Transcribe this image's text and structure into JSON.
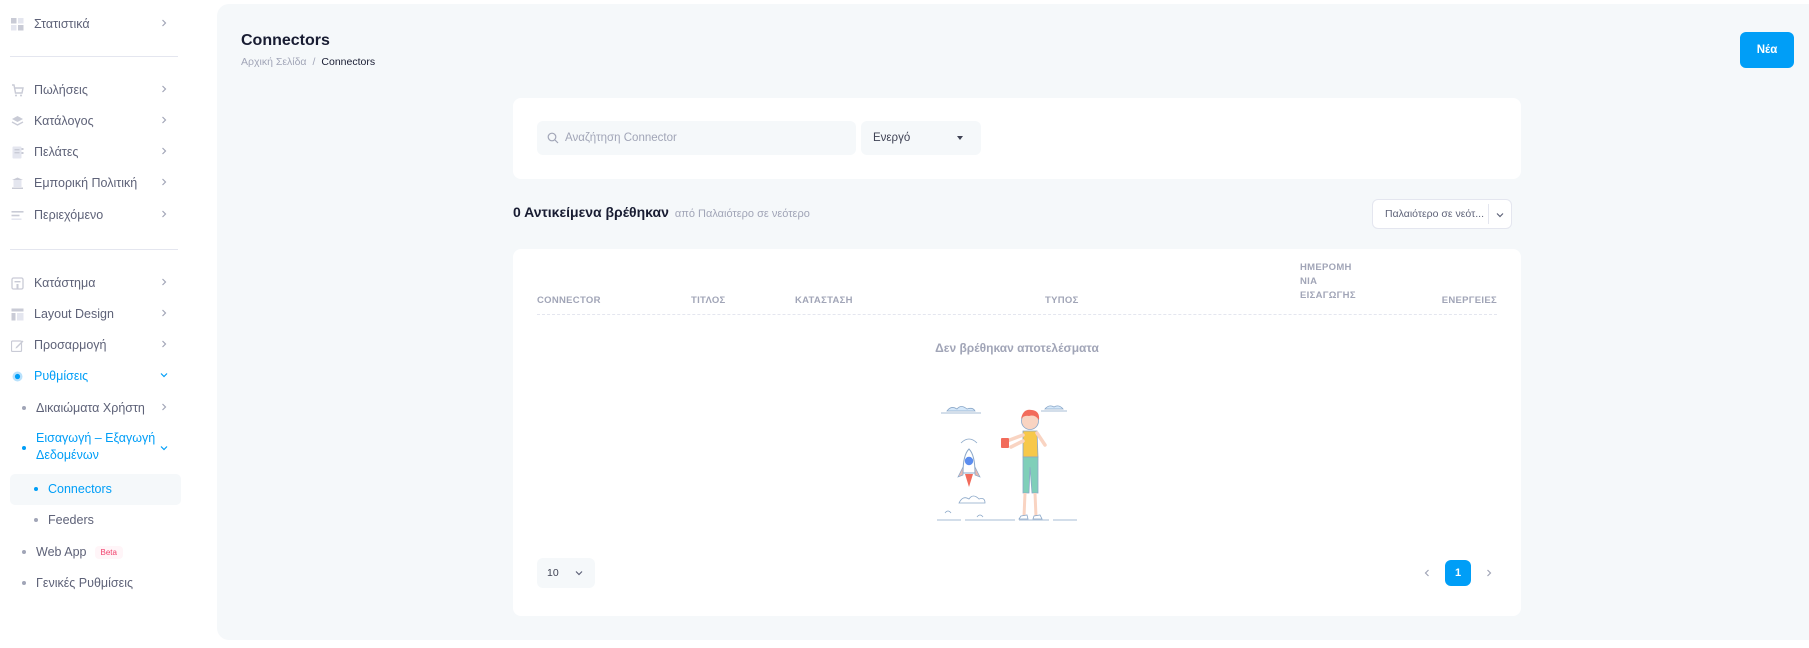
{
  "sidebar": {
    "statistics": "Στατιστικά",
    "sales": "Πωλήσεις",
    "catalog": "Κατάλογος",
    "customers": "Πελάτες",
    "commercial_policy": "Εμπορική Πολιτική",
    "content": "Περιεχόμενο",
    "store": "Κατάστημα",
    "layout_design": "Layout Design",
    "customization": "Προσαρμογή",
    "settings": "Ρυθμίσεις",
    "user_rights": "Δικαιώματα Χρήστη",
    "import_export_line1": "Εισαγωγή – Εξαγωγή",
    "import_export_line2": "Δεδομένων",
    "connectors": "Connectors",
    "feeders": "Feeders",
    "web_app": "Web App",
    "beta": "Beta",
    "general_settings": "Γενικές Ρυθμίσεις"
  },
  "header": {
    "title": "Connectors",
    "breadcrumb_home": "Αρχική Σελίδα",
    "breadcrumb_sep": "/",
    "breadcrumb_current": "Connectors",
    "new_button": "Νέα"
  },
  "filters": {
    "search_placeholder": "Αναζήτηση Connector",
    "status_value": "Ενεργό"
  },
  "results": {
    "count_title": "0 Αντικείμενα βρέθηκαν",
    "sort_text": "από Παλαιότερο σε νεότερο",
    "sort_select": "Παλαιότερο σε νεότ..."
  },
  "table": {
    "columns": [
      "CONNECTOR",
      "ΤΙΤΛΟΣ",
      "ΚΑΤΑΣΤΑΣΗ",
      "ΤΥΠΟΣ",
      "ΗΜΕΡΟΜΗ",
      "ΝΙΑ",
      "ΕΙΣΑΓΩΓΗΣ",
      "ΕΝΕΡΓΕΙΕΣ"
    ],
    "empty_text": "Δεν βρέθηκαν αποτελέσματα"
  },
  "pagination": {
    "page_size": "10",
    "current_page": "1"
  },
  "colors": {
    "accent": "#009ef7",
    "background": "#f5f8fa",
    "muted": "#a1a5b7"
  }
}
